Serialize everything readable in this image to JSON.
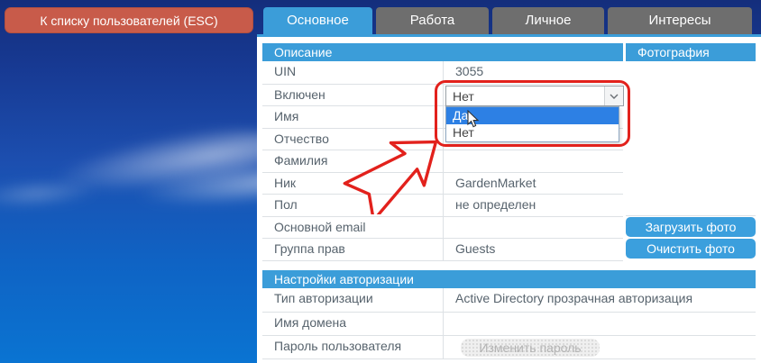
{
  "back_button": {
    "label": "К списку пользователей (ESC)"
  },
  "tabs": [
    {
      "label": "Основное",
      "active": true
    },
    {
      "label": "Работа",
      "active": false
    },
    {
      "label": "Личное",
      "active": false
    },
    {
      "label": "Интересы",
      "active": false
    }
  ],
  "description_section": {
    "title": "Описание",
    "rows": [
      {
        "label": "UIN",
        "value": "3055"
      },
      {
        "label": "Включен",
        "value": "",
        "widget": "select"
      },
      {
        "label": "Имя",
        "value": ""
      },
      {
        "label": "Отчество",
        "value": ""
      },
      {
        "label": "Фамилия",
        "value": ""
      },
      {
        "label": "Ник",
        "value": "GardenMarket"
      },
      {
        "label": "Пол",
        "value": "не определен"
      },
      {
        "label": "Основной email",
        "value": ""
      },
      {
        "label": "Группа прав",
        "value": "Guests"
      }
    ]
  },
  "enabled_dropdown": {
    "selected": "Нет",
    "options": [
      "Да",
      "Нет"
    ],
    "highlighted": "Да"
  },
  "photo_section": {
    "title": "Фотография",
    "upload_label": "Загрузить фото",
    "clear_label": "Очистить фото"
  },
  "auth_section": {
    "title": "Настройки авторизации",
    "rows": [
      {
        "label": "Тип авторизации",
        "value": "Active Directory прозрачная авторизация"
      },
      {
        "label": "Имя домена",
        "value": ""
      },
      {
        "label": "Пароль пользователя",
        "value": "Изменить пароль",
        "widget": "button"
      }
    ]
  },
  "colors": {
    "accent": "#3b9dd9",
    "tab-gray": "#6e6e6e",
    "coral": "#c85b4a",
    "red": "#e2211c",
    "hl": "#2d80e4"
  }
}
